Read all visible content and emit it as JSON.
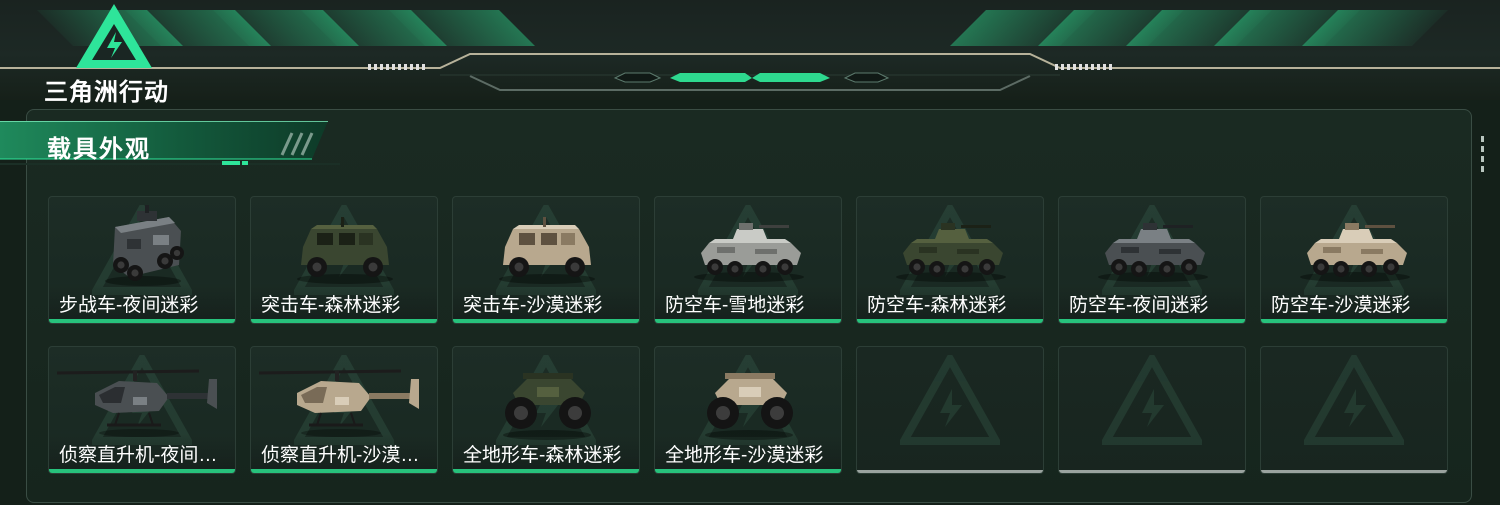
{
  "header": {
    "logo_text": "三角洲行动"
  },
  "section": {
    "title": "载具外观"
  },
  "colors": {
    "accent": "#27c27c",
    "empty_underline": "#9aa39f",
    "panel_bg": "#16251d"
  },
  "vehicles": [
    {
      "label": "步战车-夜间迷彩",
      "type": "ifv",
      "camo": "night"
    },
    {
      "label": "突击车-森林迷彩",
      "type": "assault",
      "camo": "forest"
    },
    {
      "label": "突击车-沙漠迷彩",
      "type": "assault",
      "camo": "desert"
    },
    {
      "label": "防空车-雪地迷彩",
      "type": "aa",
      "camo": "snow"
    },
    {
      "label": "防空车-森林迷彩",
      "type": "aa",
      "camo": "forest"
    },
    {
      "label": "防空车-夜间迷彩",
      "type": "aa",
      "camo": "night"
    },
    {
      "label": "防空车-沙漠迷彩",
      "type": "aa",
      "camo": "desert"
    },
    {
      "label": "侦察直升机-夜间迷彩",
      "type": "heli",
      "camo": "night"
    },
    {
      "label": "侦察直升机-沙漠迷彩",
      "type": "heli",
      "camo": "desert"
    },
    {
      "label": "全地形车-森林迷彩",
      "type": "atv",
      "camo": "forest"
    },
    {
      "label": "全地形车-沙漠迷彩",
      "type": "atv",
      "camo": "desert"
    },
    {
      "label": "",
      "type": "empty",
      "camo": ""
    },
    {
      "label": "",
      "type": "empty",
      "camo": ""
    },
    {
      "label": "",
      "type": "empty",
      "camo": ""
    }
  ]
}
